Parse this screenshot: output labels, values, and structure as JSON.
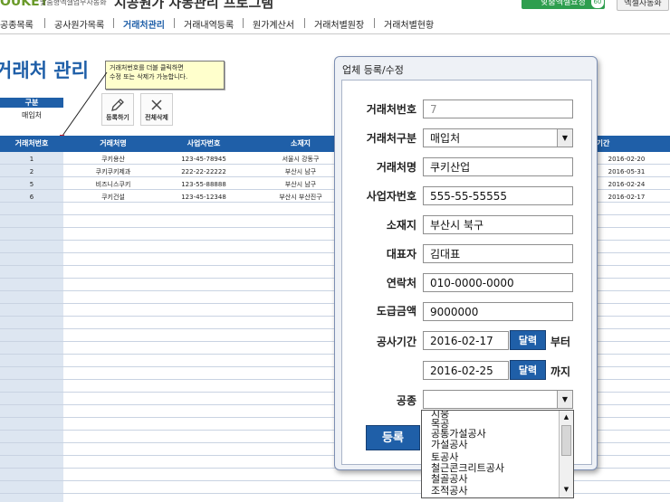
{
  "header": {
    "logo": "OUKEY",
    "logo_sub": "맞춤형엑셀업무자동화",
    "app_title": "시공원가 자동관리 프로그램",
    "btn_right1": "맞춤엑셀요청",
    "btn_right1_badge": "60",
    "btn_right2": "엑셀자동화"
  },
  "nav": {
    "items": [
      "공종목록",
      "공사원가목록",
      "거래처관리",
      "거래내역등록",
      "원가계산서",
      "거래처별원장",
      "거래처별현황"
    ],
    "active": "거래처관리"
  },
  "page": {
    "title": "거래처 관리",
    "gubun_label": "구분",
    "gubun_value": "매입처",
    "tooltip": [
      "거래처번호를 더블 클릭하면",
      "수정 또는 삭제가 가능합니다."
    ],
    "btn_register": "등록하기",
    "btn_delete_all": "전체삭제"
  },
  "table": {
    "headers": [
      "거래처번호",
      "거래처명",
      "사업자번호",
      "소재지",
      "기간"
    ],
    "rows": [
      {
        "no": "1",
        "name": "쿠키용산",
        "biz": "123-45-78945",
        "loc": "서울시 강동구",
        "date": "2016-02-20"
      },
      {
        "no": "2",
        "name": "쿠키쿠키제과",
        "biz": "222-22-22222",
        "loc": "부산시 남구",
        "date": "2016-05-31"
      },
      {
        "no": "5",
        "name": "비즈니스쿠키",
        "biz": "123-55-88888",
        "loc": "부산시 남구",
        "date": "2016-02-24"
      },
      {
        "no": "6",
        "name": "쿠키건설",
        "biz": "123-45-12348",
        "loc": "부산시 부산진구",
        "date": "2016-02-17"
      }
    ]
  },
  "dialog": {
    "title": "업체 등록/수정",
    "fields": {
      "no_label": "거래처번호",
      "no_value": "7",
      "type_label": "거래처구분",
      "type_value": "매입처",
      "name_label": "거래처명",
      "name_value": "쿠키산업",
      "biz_label": "사업자번호",
      "biz_value": "555-55-55555",
      "loc_label": "소재지",
      "loc_value": "부산시 북구",
      "rep_label": "대표자",
      "rep_value": "김대표",
      "tel_label": "연락처",
      "tel_value": "010-0000-0000",
      "amt_label": "도급금액",
      "amt_value": "9000000",
      "period_label": "공사기간",
      "start_value": "2016-02-17",
      "end_value": "2016-02-25",
      "calendar_label": "달력",
      "from_label": "부터",
      "to_label": "까지",
      "work_label": "공종",
      "work_value": ""
    },
    "submit_label": "등록",
    "dropdown_options": [
      "지붕",
      "목공",
      "공통가설공사",
      "가설공사",
      "토공사",
      "철근콘크리트공사",
      "철골공사",
      "조적공사"
    ]
  },
  "colors": {
    "accent": "#1f5fa8",
    "header_green": "#2e9e4e",
    "tooltip_bg": "#ffffcc",
    "left_column": "#dde6f1"
  }
}
